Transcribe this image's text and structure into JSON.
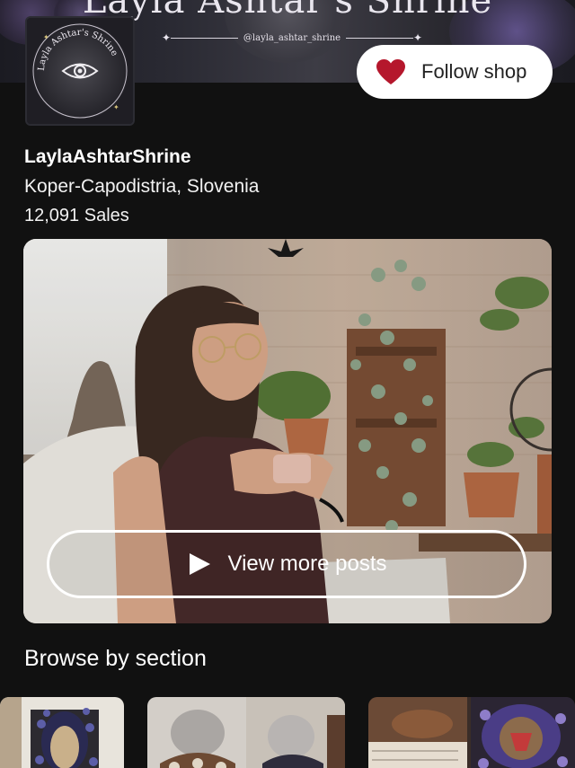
{
  "banner": {
    "title": "Layla Ashtar's Shrine",
    "handle": "@layla_ashtar_shrine"
  },
  "shop": {
    "logo_text": "Layla Ashtar's Shrine",
    "name": "LaylaAshtarShrine",
    "location": "Koper-Capodistria, Slovenia",
    "sales": "12,091 Sales"
  },
  "follow": {
    "label": "Follow shop",
    "icon": "heart-icon",
    "color": "#b5172c"
  },
  "video": {
    "button_label": "View more posts",
    "icon": "play-icon"
  },
  "browse": {
    "heading": "Browse by section"
  },
  "colors": {
    "background": "#111111",
    "text": "#ffffff",
    "button_bg": "#ffffff"
  }
}
